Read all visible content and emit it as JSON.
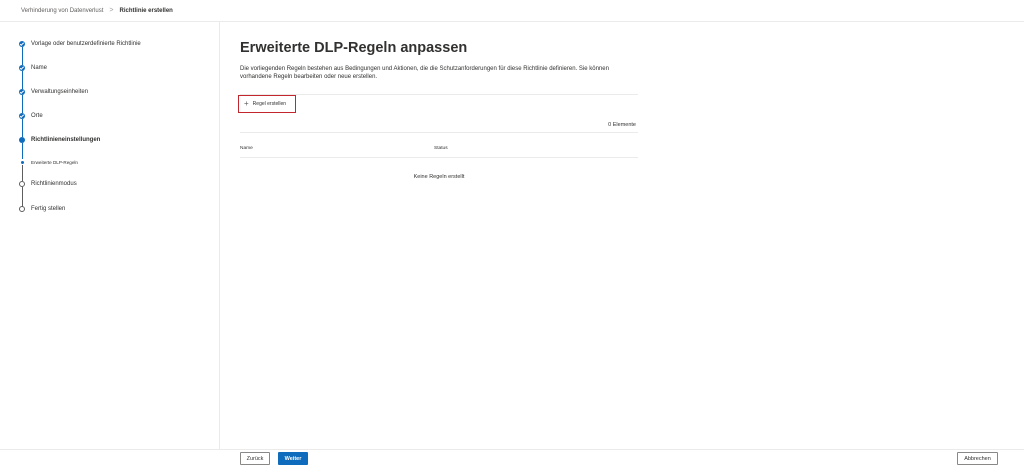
{
  "breadcrumb": {
    "parent": "Verhinderung von Datenverlust",
    "separator": ">",
    "current": "Richtlinie erstellen"
  },
  "wizard": {
    "steps": [
      {
        "label": "Vorlage oder benutzerdefinierte Richtlinie",
        "status": "completed"
      },
      {
        "label": "Name",
        "status": "completed"
      },
      {
        "label": "Verwaltungseinheiten",
        "status": "completed"
      },
      {
        "label": "Orte",
        "status": "completed"
      },
      {
        "label": "Richtlinieneinstellungen",
        "status": "current"
      },
      {
        "label": "Erweiterte DLP-Regeln",
        "status": "current-substep"
      },
      {
        "label": "Richtlinienmodus",
        "status": "not-started"
      },
      {
        "label": "Fertig stellen",
        "status": "not-started"
      }
    ]
  },
  "main": {
    "title": "Erweiterte DLP-Regeln anpassen",
    "description": "Die vorliegenden Regeln bestehen aus Bedingungen und Aktionen, die die Schutzanforderungen für diese Richtlinie definieren. Sie können vorhandene Regeln bearbeiten oder neue erstellen.",
    "create_rule_label": "Regel erstellen",
    "create_rule_icon": "plus-icon",
    "item_count": "0 Elemente",
    "columns": [
      "Name",
      "Status"
    ],
    "empty_message": "Keine Regeln erstellt"
  },
  "footer": {
    "back_label": "Zurück",
    "next_label": "Weiter",
    "cancel_label": "Abbrechen"
  },
  "colors": {
    "accent": "#0f6cbd",
    "highlight_border": "#c4262e"
  }
}
